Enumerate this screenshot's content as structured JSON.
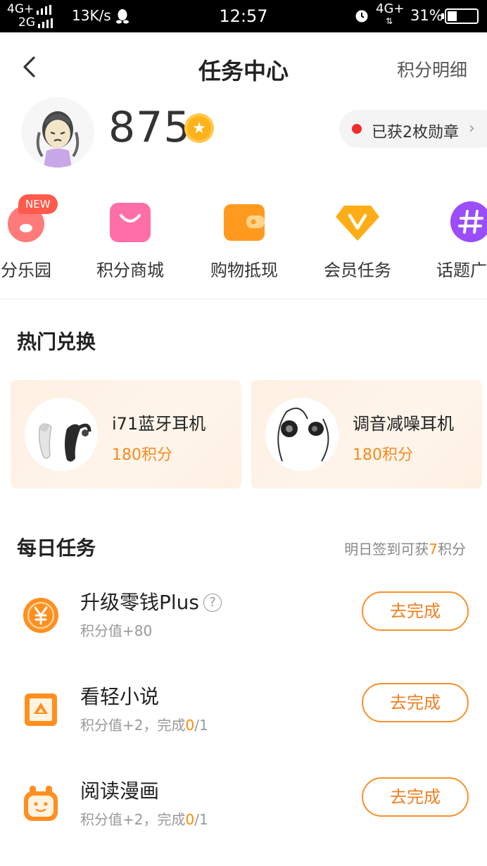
{
  "status_bar": {
    "net_top": "4G+",
    "net_bottom": "2G",
    "speed": "13K/s",
    "time": "12:57",
    "net_right": "4G+",
    "battery": "31%"
  },
  "nav": {
    "title": "任务中心",
    "right_link": "积分明细"
  },
  "profile": {
    "points": "875",
    "medals": "已获2枚勋章"
  },
  "entries": [
    {
      "label": "分乐园",
      "badge": "NEW",
      "icon": "pink-pig-icon"
    },
    {
      "label": "积分商城",
      "icon": "shopping-bag-icon"
    },
    {
      "label": "购物抵现",
      "icon": "wallet-icon"
    },
    {
      "label": "会员任务",
      "icon": "vip-diamond-icon"
    },
    {
      "label": "话题广",
      "icon": "hashtag-icon"
    }
  ],
  "hot_exchange": {
    "title": "热门兑换",
    "items": [
      {
        "name": "i71蓝牙耳机",
        "price": "180积分"
      },
      {
        "name": "调音减噪耳机",
        "price": "180积分"
      }
    ]
  },
  "daily_tasks": {
    "title": "每日任务",
    "hint_prefix": "明日签到可获",
    "hint_value": "7",
    "hint_suffix": "积分",
    "items": [
      {
        "name": "升级零钱Plus",
        "sub": "积分值+80",
        "button": "去完成",
        "icon": "yen-coin-icon"
      },
      {
        "name": "看轻小说",
        "sub_prefix": "积分值+2，完成",
        "progress_done": "0",
        "progress_total": "/1",
        "button": "去完成",
        "icon": "novel-book-icon"
      },
      {
        "name": "阅读漫画",
        "sub_prefix": "积分值+2，完成",
        "progress_done": "0",
        "progress_total": "/1",
        "button": "去完成",
        "icon": "comic-face-icon"
      }
    ]
  },
  "colors": {
    "accent": "#f8912b",
    "points_orange": "#f58a1f",
    "red_dot": "#f22b2b"
  }
}
